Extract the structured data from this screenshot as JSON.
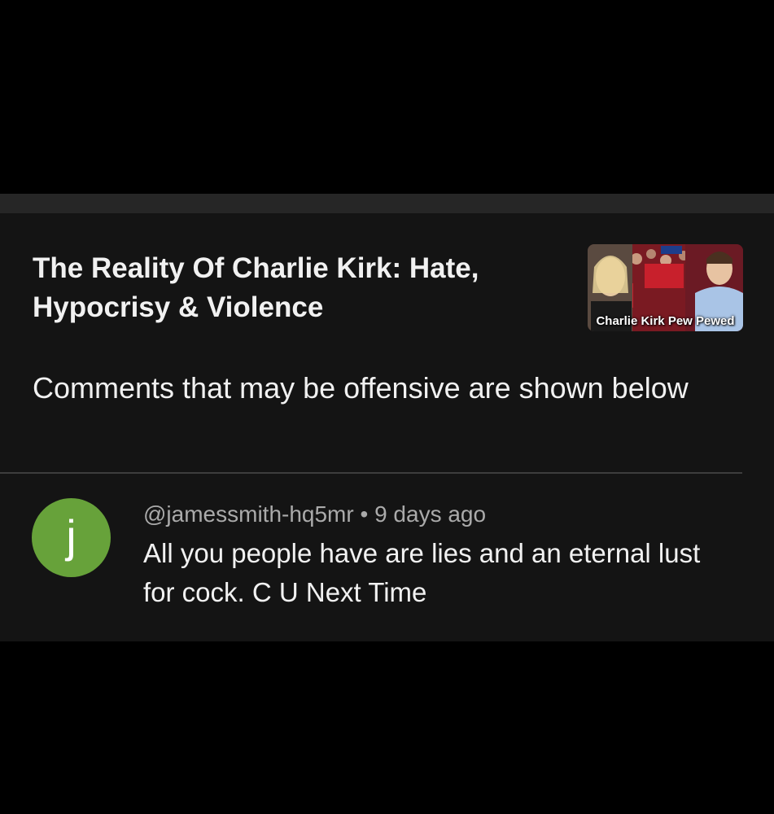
{
  "video": {
    "title": "The Reality Of Charlie Kirk: Hate, Hypocrisy & Violence",
    "thumbnail_caption": "Charlie Kirk Pew Pewed"
  },
  "notice": {
    "text": "Comments that may be offensive are shown below"
  },
  "comment": {
    "avatar_letter": "j",
    "avatar_color": "#67a23a",
    "author": "@jamessmith-hq5mr",
    "separator": "•",
    "time": "9 days ago",
    "text": "All you people have are lies and an eternal lust for cock. C U Next Time"
  }
}
